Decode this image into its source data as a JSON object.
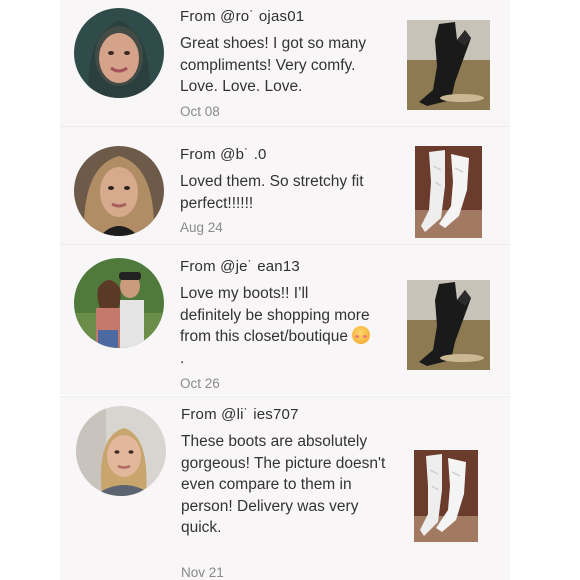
{
  "reviews": [
    {
      "from": "From @ro˙    ojas01",
      "text": "Great shoes! I got so many compliments! Very comfy. Love. Love. Love.",
      "date": "Oct 08",
      "product": "black-boot"
    },
    {
      "from": "From @b˙  .0",
      "text": "Loved them. So stretchy fit perfect!!!!!!",
      "date": "Aug 24",
      "product": "white-boot"
    },
    {
      "from": "From @je˙      ean13",
      "text": "Love my boots!! I’ll definitely be shopping more from this closet/boutique",
      "date": "Oct 26",
      "product": "black-boot"
    },
    {
      "from": "From @li˙        ies707",
      "text": "These boots are absolutely gorgeous! The picture doesn't even compare to them in person! Delivery was very quick.",
      "date": "Nov 21",
      "product": "white-boot"
    }
  ]
}
